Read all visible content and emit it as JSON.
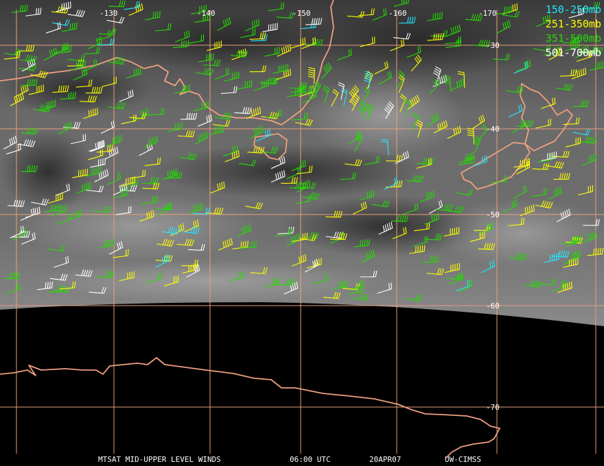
{
  "title_bar": {
    "satellite_product": "MTSAT MID-UPPER LEVEL WINDS",
    "time": "06:00 UTC",
    "date": "20APR07",
    "credit": "UW-CIMSS"
  },
  "legend": [
    {
      "label": "150-250mb",
      "color": "#22e8ff"
    },
    {
      "label": "251-350mb",
      "color": "#ffff00"
    },
    {
      "label": "351-500mb",
      "color": "#22dd00"
    },
    {
      "label": "501-700mb",
      "color": "#ffffff"
    }
  ],
  "longitude_labels": [
    "130",
    "140",
    "150",
    "160",
    "170"
  ],
  "latitude_labels": [
    "30",
    "40",
    "50",
    "60",
    "70"
  ],
  "colors": {
    "background": "#000000",
    "grid": "#e8a07a",
    "coastline": "#f0a080",
    "label_text": "#ffffff"
  },
  "wind_barbs": {
    "shown": true,
    "color_by": "pressure layer (legend)"
  }
}
